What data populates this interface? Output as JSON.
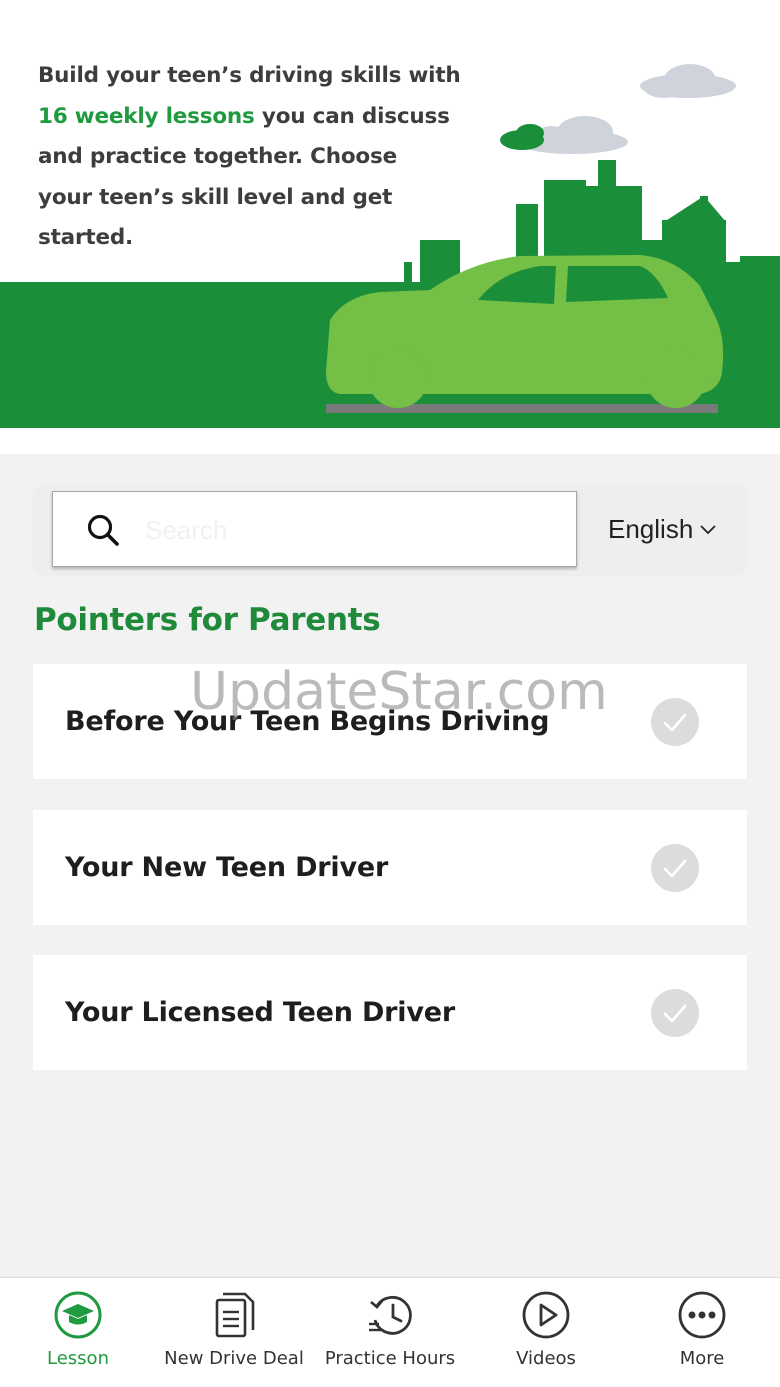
{
  "hero": {
    "text_line1": "Build your teen’s driving skills with",
    "text_highlight": "16 weekly lessons",
    "text_line2_rest": " you can discuss",
    "text_line3": "and practice together. Choose",
    "text_line4": "your teen’s skill level and get",
    "text_line5": "started.",
    "illustration": "green-city-skyline-with-car"
  },
  "search": {
    "placeholder": "Search",
    "value": "",
    "icon": "search-icon"
  },
  "language": {
    "selected": "English",
    "icon": "chevron-down-icon"
  },
  "section": {
    "title": "Pointers for Parents"
  },
  "watermark": "UpdateStar.com",
  "cards": [
    {
      "label": "Before Your Teen Begins Driving",
      "icon": "check-circle-icon"
    },
    {
      "label": "Your New Teen Driver",
      "icon": "check-circle-icon"
    },
    {
      "label": "Your Licensed Teen Driver",
      "icon": "check-circle-icon"
    }
  ],
  "tabs": [
    {
      "label": "Lesson",
      "icon": "graduation-cap-icon",
      "active": true
    },
    {
      "label": "New Drive Deal",
      "icon": "document-icon",
      "active": false
    },
    {
      "label": "Practice Hours",
      "icon": "history-clock-icon",
      "active": false
    },
    {
      "label": "Videos",
      "icon": "play-circle-icon",
      "active": false
    },
    {
      "label": "More",
      "icon": "more-dots-icon",
      "active": false
    }
  ],
  "colors": {
    "brand_green": "#1f9a3f",
    "dark_green": "#1b8e3a",
    "car_green": "#74bf45",
    "background": "#f2f2f2",
    "check_gray": "#dcdcdc"
  }
}
